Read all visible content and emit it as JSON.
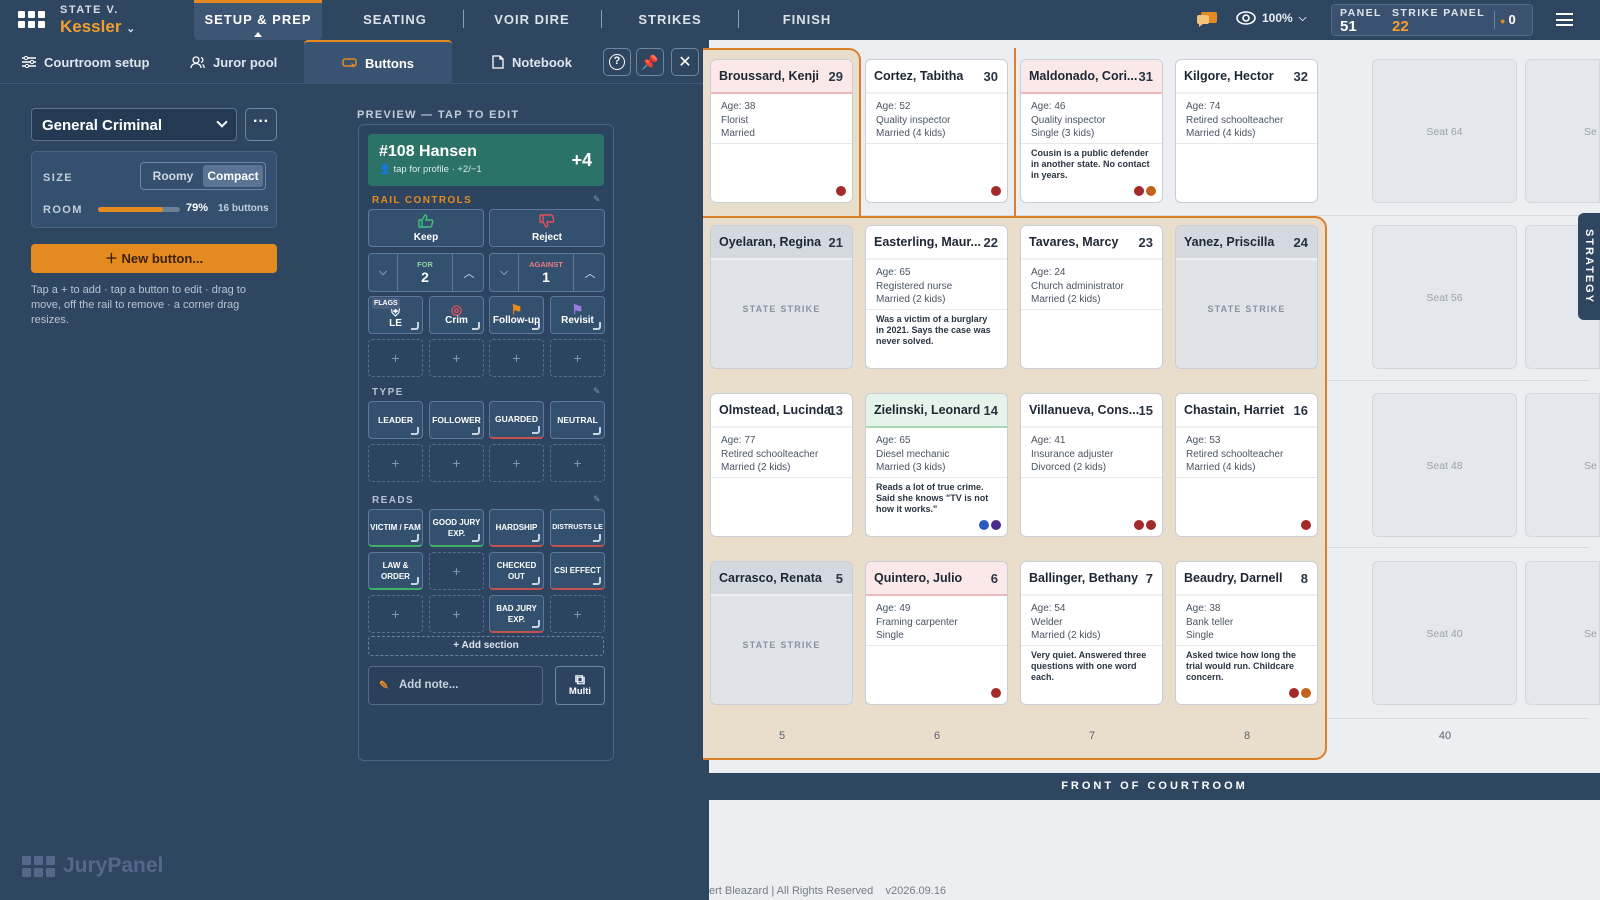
{
  "header": {
    "case_prefix": "STATE V.",
    "case_name": "Kessler",
    "nav": [
      "SETUP & PREP",
      "SEATING",
      "VOIR DIRE",
      "STRIKES",
      "FINISH"
    ],
    "zoom": "100%",
    "panel_label": "PANEL",
    "panel_value": "51",
    "strike_label": "STRIKE PANEL",
    "strike_value": "22",
    "count": "0"
  },
  "panel_tabs": [
    "Courtroom setup",
    "Juror pool",
    "Buttons",
    "Notebook"
  ],
  "setup": {
    "preset": "General Criminal",
    "size_label": "SIZE",
    "size_options": [
      "Roomy",
      "Compact"
    ],
    "selected_size": "Compact",
    "room_label": "ROOM",
    "room_pct": "79%",
    "room_fraction": 0.79,
    "room_count": "16 buttons",
    "new_button": "New button...",
    "help": "Tap a + to add · tap a button to edit · drag to move, off the rail to remove · a corner drag resizes."
  },
  "preview": {
    "label": "PREVIEW — TAP TO EDIT",
    "juror": "#108 Hansen",
    "sub": "tap for profile · +2/−1",
    "score": "+4",
    "rail_label": "RAIL CONTROLS",
    "keep": "Keep",
    "reject": "Reject",
    "for_label": "FOR",
    "for_value": "2",
    "against_label": "AGAINST",
    "against_value": "1",
    "flags_tag": "FLAGS",
    "flags": [
      "LE",
      "Crim",
      "Follow-up",
      "Revisit"
    ],
    "type_label": "TYPE",
    "types": [
      "LEADER",
      "FOLLOWER",
      "GUARDED",
      "NEUTRAL"
    ],
    "reads_label": "READS",
    "reads_row1": [
      "VICTIM / FAM",
      "GOOD JURY EXP.",
      "HARDSHIP",
      "DISTRUSTS LE"
    ],
    "reads_row2": [
      "LAW & ORDER",
      "CHECKED OUT",
      "CSI EFFECT"
    ],
    "reads_row3": [
      "BAD JURY EXP."
    ],
    "add_section": "+ Add section",
    "add_note": "Add note...",
    "multi": "Multi"
  },
  "brand": "JuryPanel",
  "seats": {
    "row1": [
      {
        "name": "Broussard, Kenji",
        "num": "29",
        "age": "Age: 38",
        "job": "Florist",
        "family": "Married",
        "note": "",
        "dots": [
          "#a32a2a"
        ],
        "style": "pink"
      },
      {
        "name": "Cortez, Tabitha",
        "num": "30",
        "age": "Age: 52",
        "job": "Quality inspector",
        "family": "Married (4 kids)",
        "note": "",
        "dots": [
          "#a32a2a"
        ],
        "style": ""
      },
      {
        "name": "Maldonado, Cori...",
        "num": "31",
        "age": "Age: 46",
        "job": "Quality inspector",
        "family": "Single (3 kids)",
        "note": "Cousin is a public defender in another state. No contact in years.",
        "dots": [
          "#a32a2a",
          "#c4621d"
        ],
        "style": "pink"
      },
      {
        "name": "Kilgore, Hector",
        "num": "32",
        "age": "Age: 74",
        "job": "Retired schoolteacher",
        "family": "Married (4 kids)",
        "note": "",
        "dots": [],
        "style": ""
      }
    ],
    "row2": [
      {
        "name": "Oyelaran, Regina",
        "num": "21",
        "struck": "STATE STRIKE"
      },
      {
        "name": "Easterling, Maur...",
        "num": "22",
        "age": "Age: 65",
        "job": "Registered nurse",
        "family": "Married (2 kids)",
        "note": "Was a victim of a burglary in 2021. Says the case was never solved.",
        "dots": [],
        "style": ""
      },
      {
        "name": "Tavares, Marcy",
        "num": "23",
        "age": "Age: 24",
        "job": "Church administrator",
        "family": "Married (2 kids)",
        "note": "",
        "dots": [],
        "style": ""
      },
      {
        "name": "Yanez, Priscilla",
        "num": "24",
        "struck": "STATE STRIKE"
      }
    ],
    "row3": [
      {
        "name": "Olmstead, Lucinda",
        "num": "13",
        "age": "Age: 77",
        "job": "Retired schoolteacher",
        "family": "Married (2 kids)",
        "note": "",
        "dots": [],
        "style": ""
      },
      {
        "name": "Zielinski, Leonard",
        "num": "14",
        "age": "Age: 65",
        "job": "Diesel mechanic",
        "family": "Married (3 kids)",
        "note": "Reads a lot of true crime. Said she knows \"TV is not how it works.\"",
        "dots": [
          "#2a5bc4",
          "#4b2a8a"
        ],
        "style": "green"
      },
      {
        "name": "Villanueva, Cons...",
        "num": "15",
        "age": "Age: 41",
        "job": "Insurance adjuster",
        "family": "Divorced (2 kids)",
        "note": "",
        "dots": [
          "#a32a2a",
          "#a32a2a"
        ],
        "style": ""
      },
      {
        "name": "Chastain, Harriet",
        "num": "16",
        "age": "Age: 53",
        "job": "Retired schoolteacher",
        "family": "Married (4 kids)",
        "note": "",
        "dots": [
          "#a32a2a"
        ],
        "style": ""
      }
    ],
    "row4": [
      {
        "name": "Carrasco, Renata",
        "num": "5",
        "struck": "STATE STRIKE"
      },
      {
        "name": "Quintero, Julio",
        "num": "6",
        "age": "Age: 49",
        "job": "Framing carpenter",
        "family": "Single",
        "note": "",
        "dots": [
          "#a32a2a"
        ],
        "style": "pink"
      },
      {
        "name": "Ballinger, Bethany",
        "num": "7",
        "age": "Age: 54",
        "job": "Welder",
        "family": "Married (2 kids)",
        "note": "Very quiet. Answered three questions with one word each.",
        "dots": [],
        "style": ""
      },
      {
        "name": "Beaudry, Darnell",
        "num": "8",
        "age": "Age: 38",
        "job": "Bank teller",
        "family": "Single",
        "note": "Asked twice how long the trial would run. Childcare concern.",
        "dots": [
          "#a32a2a",
          "#c4621d"
        ],
        "style": ""
      }
    ],
    "empty": [
      "Seat 64",
      "Seat 56",
      "Seat 48",
      "Seat 40"
    ],
    "partial": "Se",
    "cols": [
      "5",
      "6",
      "7",
      "8",
      "40"
    ]
  },
  "front": "FRONT OF COURTROOM",
  "footer": "ert Bleazard | All Rights Reserved",
  "version": "v2026.09.16",
  "strategy": "STRATEGY"
}
